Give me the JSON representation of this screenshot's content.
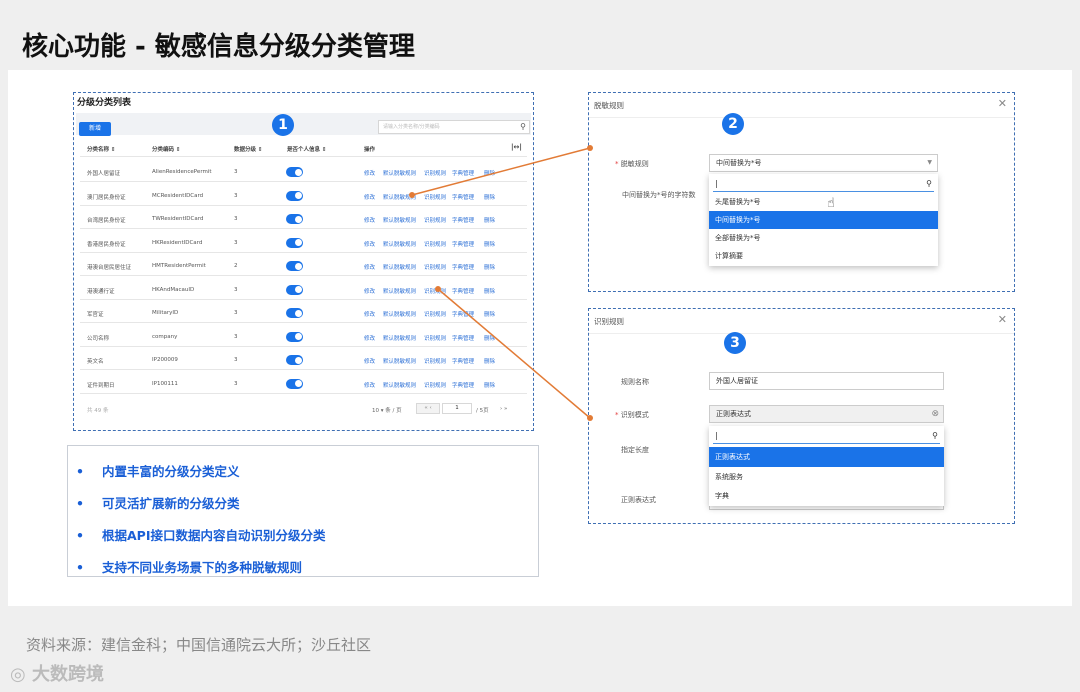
{
  "title": "核心功能 - 敏感信息分级分类管理",
  "panel1": {
    "title": "分级分类列表",
    "new_btn": "新增",
    "search_placeholder": "请输入分类名称/分类编码",
    "badge": "1",
    "headers": [
      "分类名称 ⇕",
      "分类编码 ⇕",
      "数据分级 ⇕",
      "是否个人信息 ⇕",
      "操作"
    ],
    "rows": [
      [
        "外国人居留证",
        "AlienResidencePermit",
        "3"
      ],
      [
        "澳门居民身份证",
        "MCResidentIDCard",
        "3"
      ],
      [
        "台湾居民身份证",
        "TWResidentIDCard",
        "3"
      ],
      [
        "香港居民身份证",
        "HKResidentIDCard",
        "3"
      ],
      [
        "港澳台居民居住证",
        "HMTResidentPermit",
        "2"
      ],
      [
        "港澳通行证",
        "HKAndMacauID",
        "3"
      ],
      [
        "军官证",
        "MilitaryID",
        "3"
      ],
      [
        "公司名称",
        "company",
        "3"
      ],
      [
        "英文名",
        "IP200009",
        "3"
      ],
      [
        "证件到期日",
        "IP100111",
        "3"
      ]
    ],
    "ops": [
      "修改",
      "默认脱敏规则",
      "识别规则",
      "字典管理",
      "删除"
    ],
    "total": "共 49 条",
    "page_size": "10 ▾ 条 / 页",
    "page_num": "1",
    "page_total": "/ 5页"
  },
  "bullets": [
    "内置丰富的分级分类定义",
    "可灵活扩展新的分级分类",
    "根据API接口数据内容自动识别分级分类",
    "支持不同业务场景下的多种脱敏规则"
  ],
  "panel2": {
    "title": "脱敏规则",
    "badge": "2",
    "label": "脱敏规则",
    "value": "中间替换为*号",
    "label2": "中间替换为*号的字符数",
    "options": [
      "头尾替换为*号",
      "中间替换为*号",
      "全部替换为*号",
      "计算摘要"
    ]
  },
  "panel3": {
    "title": "识别规则",
    "badge": "3",
    "label_name": "规则名称",
    "value_name": "外国人居留证",
    "label_mode": "识别模式",
    "value_mode": "正则表达式",
    "label_len": "指定长度",
    "label_regex": "正则表达式",
    "options": [
      "正则表达式",
      "系统服务",
      "字典"
    ]
  },
  "source": "资料来源：建信金科；中国信通院云大所；沙丘社区",
  "logo": "大数跨境"
}
